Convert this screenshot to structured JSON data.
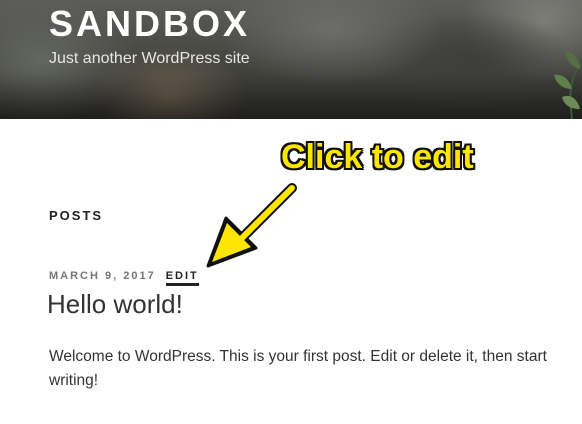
{
  "header": {
    "site_title": "SANDBOX",
    "tagline": "Just another WordPress site"
  },
  "main": {
    "section_title": "POSTS",
    "post": {
      "date": "MARCH 9, 2017",
      "edit_label": "EDIT",
      "title": "Hello world!",
      "content": "Welcome to WordPress. This is your first post. Edit or delete it, then start writing!"
    }
  },
  "annotation": {
    "callout_text": "Click to edit",
    "arrow_icon": "arrow-down-left-icon",
    "color": "#ffe600"
  },
  "colors": {
    "text": "#333333",
    "meta": "#767676",
    "heading": "#222222"
  }
}
